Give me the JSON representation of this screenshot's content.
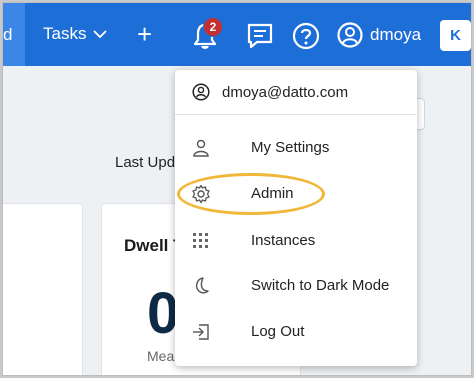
{
  "topbar": {
    "left_stub_text": "d",
    "tasks_label": "Tasks",
    "notification_count": "2",
    "username": "dmoya",
    "brand_letter": "K"
  },
  "page": {
    "last_updated_label": "Last Upd",
    "card_title": "Dwell T",
    "card_value": "0",
    "card_caption": "Mea"
  },
  "user_menu": {
    "email": "dmoya@datto.com",
    "items": [
      {
        "label": "My Settings",
        "icon": "person-icon"
      },
      {
        "label": "Admin",
        "icon": "gear-icon"
      },
      {
        "label": "Instances",
        "icon": "grid-icon"
      },
      {
        "label": "Switch to Dark Mode",
        "icon": "moon-icon"
      },
      {
        "label": "Log Out",
        "icon": "logout-icon"
      }
    ]
  },
  "colors": {
    "topbar": "#1e6ed8",
    "badge": "#c62f2f",
    "highlight": "#f0b739"
  }
}
